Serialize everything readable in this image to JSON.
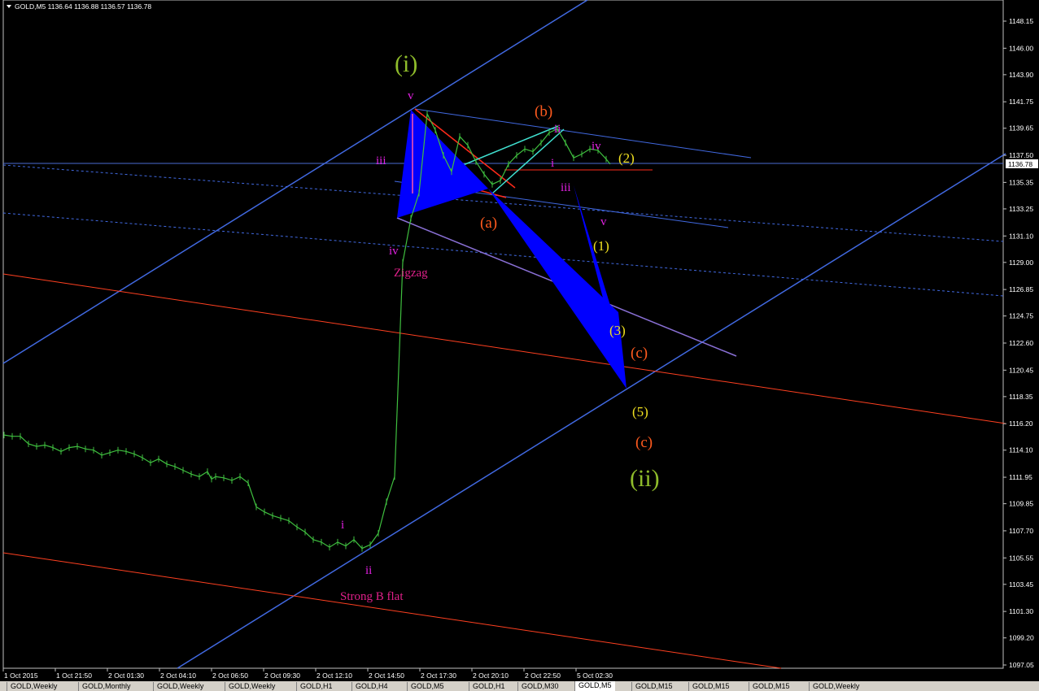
{
  "header": {
    "symbol_text": "GOLD,M5  1136.64 1136.88 1136.57 1136.78"
  },
  "price_axis": {
    "labels": [
      "1148.15",
      "1146.00",
      "1143.90",
      "1141.75",
      "1139.65",
      "1137.50",
      "1135.35",
      "1133.25",
      "1131.10",
      "1129.00",
      "1126.85",
      "1124.75",
      "1122.60",
      "1120.45",
      "1118.35",
      "1116.20",
      "1114.10",
      "1111.95",
      "1109.85",
      "1107.70",
      "1105.55",
      "1103.45",
      "1101.30",
      "1099.20",
      "1097.05"
    ],
    "current": "1136.78"
  },
  "time_axis": {
    "labels": [
      "1 Oct 2015",
      "1 Oct 21:50",
      "2 Oct 01:30",
      "2 Oct 04:10",
      "2 Oct 06:50",
      "2 Oct 09:30",
      "2 Oct 12:10",
      "2 Oct 14:50",
      "2 Oct 17:30",
      "2 Oct 20:10",
      "2 Oct 22:50",
      "5 Oct 02:30"
    ]
  },
  "annotations": [
    {
      "text": "(i)",
      "color": "#8fbc2b"
    },
    {
      "text": "v",
      "color": "#e020e0"
    },
    {
      "text": "iii",
      "color": "#e020e0"
    },
    {
      "text": "iv",
      "color": "#e020e0"
    },
    {
      "text": "Zigzag",
      "color": "#e0208a"
    },
    {
      "text": "(b)",
      "color": "#ff5a1e"
    },
    {
      "text": "ii",
      "color": "#e020e0"
    },
    {
      "text": "i",
      "color": "#e020e0"
    },
    {
      "text": "iv",
      "color": "#e020e0"
    },
    {
      "text": "(2)",
      "color": "#f0e020"
    },
    {
      "text": "iii",
      "color": "#e020e0"
    },
    {
      "text": "(a)",
      "color": "#ff5a1e"
    },
    {
      "text": "v",
      "color": "#e020e0"
    },
    {
      "text": "(1)",
      "color": "#f0e020"
    },
    {
      "text": "(3)",
      "color": "#f0e020"
    },
    {
      "text": "(c)",
      "color": "#ff5a1e"
    },
    {
      "text": "(5)",
      "color": "#f0e020"
    },
    {
      "text": "(c)",
      "color": "#ff5a1e"
    },
    {
      "text": "(ii)",
      "color": "#8fbc2b"
    },
    {
      "text": "i",
      "color": "#e020e0"
    },
    {
      "text": "ii",
      "color": "#e020e0"
    },
    {
      "text": "Strong B flat",
      "color": "#e0208a"
    }
  ],
  "tabs": [
    "GOLD,Weekly",
    "GOLD,Monthly",
    "GOLD,Weekly",
    "GOLD,Weekly",
    "GOLD,H1",
    "GOLD,H4",
    "GOLD,M5",
    "GOLD,H1",
    "GOLD,M30",
    "GOLD,M5",
    "GOLD,M15",
    "GOLD,M15",
    "GOLD,M15",
    "GOLD,Weekly"
  ],
  "active_tab": "GOLD,M5",
  "colors": {
    "candles": "#3fbf3f",
    "channel": "#4169e1",
    "red_lines": "#ff2a1a",
    "wedge_fill": "#0000ff"
  },
  "chart_data": {
    "type": "line",
    "title": "GOLD,M5",
    "ohlc_last": {
      "open": 1136.64,
      "high": 1136.88,
      "low": 1136.57,
      "close": 1136.78
    },
    "ylim": [
      1096,
      1149
    ],
    "y_ticks": [
      1148.15,
      1146.0,
      1143.9,
      1141.75,
      1139.65,
      1137.5,
      1135.35,
      1133.25,
      1131.1,
      1129.0,
      1126.85,
      1124.75,
      1122.6,
      1120.45,
      1118.35,
      1116.2,
      1114.1,
      1111.95,
      1109.85,
      1107.7,
      1105.55,
      1103.45,
      1101.3,
      1099.2,
      1097.05
    ],
    "x_tick_labels": [
      "1 Oct 2015",
      "1 Oct 21:50",
      "2 Oct 01:30",
      "2 Oct 04:10",
      "2 Oct 06:50",
      "2 Oct 09:30",
      "2 Oct 12:10",
      "2 Oct 14:50",
      "2 Oct 17:30",
      "2 Oct 20:10",
      "2 Oct 22:50",
      "5 Oct 02:30"
    ],
    "series": [
      {
        "name": "GOLD,M5",
        "bar_index": [
          0,
          10,
          20,
          30,
          40,
          50,
          60,
          70,
          80,
          90,
          100,
          110,
          120,
          130,
          140,
          150,
          160,
          170,
          180,
          190,
          200,
          210,
          220,
          230,
          240,
          250,
          255,
          260,
          270,
          280,
          290,
          300,
          310,
          320,
          330,
          340,
          350,
          360,
          370,
          380,
          390,
          400,
          410,
          420,
          430,
          440,
          450,
          460,
          470,
          480,
          490,
          500,
          510,
          520,
          530,
          540,
          550,
          560,
          570,
          580,
          590,
          600,
          610,
          620,
          630,
          640,
          650,
          660,
          670,
          680,
          690,
          700,
          710,
          720,
          730,
          740,
          745
        ],
        "values": [
          1115.3,
          1115.2,
          1115.2,
          1114.6,
          1114.4,
          1114.5,
          1114.3,
          1114.0,
          1114.3,
          1114.4,
          1114.2,
          1114.1,
          1113.7,
          1113.9,
          1114.1,
          1114.0,
          1113.8,
          1113.5,
          1113.1,
          1113.4,
          1113.0,
          1112.8,
          1112.5,
          1112.2,
          1112.0,
          1112.4,
          1111.8,
          1112.0,
          1111.9,
          1111.7,
          1112.0,
          1111.5,
          1109.6,
          1109.2,
          1108.9,
          1108.7,
          1108.5,
          1108.0,
          1107.6,
          1107.0,
          1106.8,
          1106.4,
          1106.8,
          1106.5,
          1107.0,
          1106.3,
          1106.6,
          1107.5,
          1110.0,
          1112.0,
          1129.0,
          1132.5,
          1134.5,
          1140.8,
          1139.5,
          1137.5,
          1136.2,
          1139.0,
          1138.3,
          1137.0,
          1136.0,
          1135.2,
          1135.5,
          1136.8,
          1137.5,
          1138.0,
          1137.8,
          1138.5,
          1139.3,
          1139.6,
          1138.5,
          1137.3,
          1137.6,
          1138.0,
          1137.9,
          1137.2,
          1136.8
        ]
      }
    ]
  }
}
